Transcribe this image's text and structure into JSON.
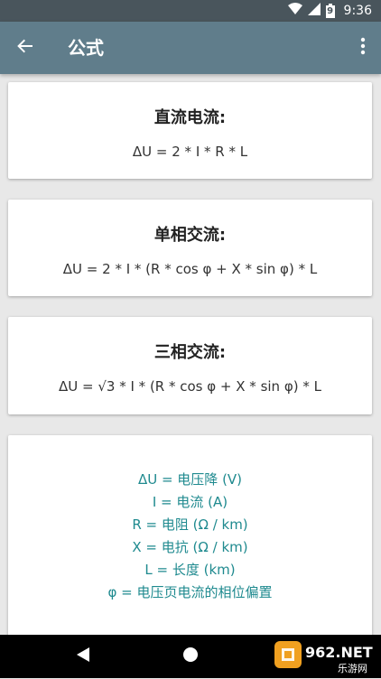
{
  "status_bar": {
    "time": "9:36",
    "battery_level": "9"
  },
  "app_bar": {
    "title": "公式"
  },
  "cards": [
    {
      "title": "直流电流:",
      "formula": "ΔU = 2 * I * R * L"
    },
    {
      "title": "单相交流:",
      "formula": "ΔU = 2 * I * (R * cos φ + X * sin φ) * L"
    },
    {
      "title": "三相交流:",
      "formula": "ΔU = √3 * I * (R * cos φ + X * sin φ) * L"
    }
  ],
  "legend": [
    "ΔU = 电压降 (V)",
    "I = 电流 (A)",
    "R = 电阻 (Ω / km)",
    "X = 电抗 (Ω / km)",
    "L = 长度 (km)",
    "φ = 电压页电流的相位偏置"
  ],
  "watermark": {
    "brand": "962.NET",
    "site": "乐游网"
  },
  "colors": {
    "app_bar": "#607d8b",
    "status_bar": "#49555c",
    "legend_text": "#1f8a8f",
    "background": "#e8e8e8"
  },
  "icons": {
    "back": "arrow-left-icon",
    "menu": "more-vert-icon",
    "nav_back": "triangle-back-icon",
    "nav_home": "circle-home-icon"
  }
}
